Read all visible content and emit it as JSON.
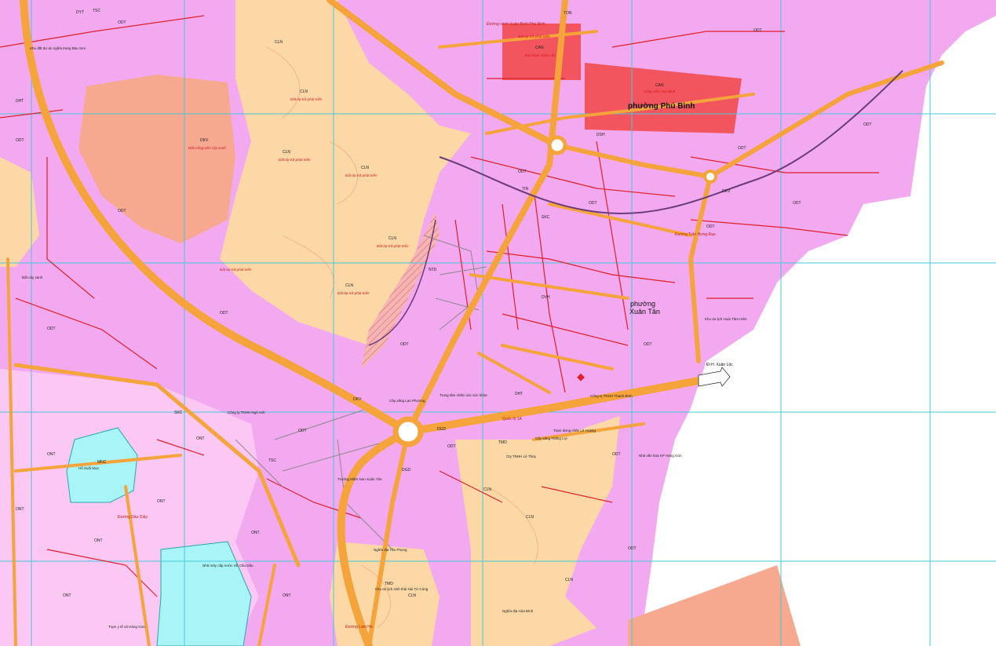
{
  "map": {
    "wards": [
      {
        "id": "phu-binh",
        "name": "phường Phú Bình"
      },
      {
        "id": "xuan-tan-1",
        "name": "phường"
      },
      {
        "id": "xuan-tan-2",
        "name": "Xuân Tân"
      }
    ],
    "directions": [
      {
        "id": "xuan-loc",
        "label": "Đi H. Xuân Lộc"
      }
    ],
    "roads": [
      {
        "id": "ql1a",
        "label": "Quốc lộ 1A"
      },
      {
        "id": "dau-giay",
        "label": "Đường Dầu Giây"
      },
      {
        "id": "dt-763",
        "label": "Đường Trần Hưng Đạo"
      },
      {
        "id": "xb",
        "label": "Đường vành Xuân Bình-Phú Bình"
      },
      {
        "id": "lang-ha",
        "label": "Đường Lâm Hà"
      }
    ],
    "land_codes": [
      {
        "id": "c1",
        "text": "CLN"
      },
      {
        "id": "c2",
        "text": "CLN"
      },
      {
        "id": "c3",
        "text": "CLN"
      },
      {
        "id": "c4",
        "text": "CLN"
      },
      {
        "id": "c5",
        "text": "CLN"
      },
      {
        "id": "c6",
        "text": "CLN"
      },
      {
        "id": "c7",
        "text": "CLN"
      },
      {
        "id": "c8",
        "text": "CLN"
      },
      {
        "id": "c9",
        "text": "CLN"
      },
      {
        "id": "c10",
        "text": "CLN"
      },
      {
        "id": "o1",
        "text": "ODT"
      },
      {
        "id": "o2",
        "text": "ODT"
      },
      {
        "id": "o3",
        "text": "ODT"
      },
      {
        "id": "o4",
        "text": "ODT"
      },
      {
        "id": "o5",
        "text": "ODT"
      },
      {
        "id": "o6",
        "text": "ODT"
      },
      {
        "id": "o7",
        "text": "ODT"
      },
      {
        "id": "o8",
        "text": "ODT"
      },
      {
        "id": "o9",
        "text": "ODT"
      },
      {
        "id": "o10",
        "text": "ODT"
      },
      {
        "id": "o11",
        "text": "ODT"
      },
      {
        "id": "o12",
        "text": "ODT"
      },
      {
        "id": "o13",
        "text": "ODT"
      },
      {
        "id": "o14",
        "text": "ODT"
      },
      {
        "id": "o15",
        "text": "ODT"
      },
      {
        "id": "o16",
        "text": "ODT"
      },
      {
        "id": "o17",
        "text": "ODT"
      },
      {
        "id": "o18",
        "text": "ODT"
      },
      {
        "id": "n1",
        "text": "ONT"
      },
      {
        "id": "n2",
        "text": "ONT"
      },
      {
        "id": "n3",
        "text": "ONT"
      },
      {
        "id": "n4",
        "text": "ONT"
      },
      {
        "id": "n5",
        "text": "ONT"
      },
      {
        "id": "n6",
        "text": "ONT"
      },
      {
        "id": "n7",
        "text": "ONT"
      },
      {
        "id": "n8",
        "text": "ONT"
      },
      {
        "id": "can1",
        "text": "CAN"
      },
      {
        "id": "can2",
        "text": "CAN"
      },
      {
        "id": "dkv1",
        "text": "DKV"
      },
      {
        "id": "dkv2",
        "text": "DKV"
      },
      {
        "id": "dkv3",
        "text": "DKV"
      },
      {
        "id": "skc1",
        "text": "SKC"
      },
      {
        "id": "skc2",
        "text": "SKC"
      },
      {
        "id": "tmd1",
        "text": "TMD"
      },
      {
        "id": "tmd2",
        "text": "TMD"
      },
      {
        "id": "mnc1",
        "text": "MNC"
      },
      {
        "id": "dht1",
        "text": "DHT"
      },
      {
        "id": "dht2",
        "text": "DHT"
      },
      {
        "id": "tsc1",
        "text": "TSC"
      },
      {
        "id": "tsc2",
        "text": "TSC"
      },
      {
        "id": "dgd1",
        "text": "DGD"
      },
      {
        "id": "dgd2",
        "text": "DGD"
      },
      {
        "id": "ntd1",
        "text": "NTD"
      },
      {
        "id": "dsh1",
        "text": "DSH"
      },
      {
        "id": "dvh1",
        "text": "DVH"
      },
      {
        "id": "tin1",
        "text": "TIN"
      },
      {
        "id": "dyt1",
        "text": "DYT"
      },
      {
        "id": "ton1",
        "text": "TON"
      }
    ],
    "annotations": [
      {
        "id": "a1",
        "text": "Đất dự trữ phát triển"
      },
      {
        "id": "a2",
        "text": "Đất dự trữ phát triển"
      },
      {
        "id": "a3",
        "text": "Đất dự trữ phát triển"
      },
      {
        "id": "a4",
        "text": "Đất dự trữ phát triển"
      },
      {
        "id": "a5",
        "text": "Đất dự trữ phát triển"
      },
      {
        "id": "a6",
        "text": "Đất dự trữ phát triển"
      },
      {
        "id": "a7",
        "text": "Đất dự trữ phát triển"
      },
      {
        "id": "a8",
        "text": "Đất Công viên cây xanh"
      },
      {
        "id": "a9",
        "text": "Công viên Hòa Bình"
      },
      {
        "id": "a10",
        "text": "Trại Giam Xuân Lộc"
      },
      {
        "id": "a11",
        "text": "Hồ Suối Mực"
      },
      {
        "id": "a12",
        "text": "Nhà máy cấp nước Hồ Cầu Dầu"
      },
      {
        "id": "a13",
        "text": "Khu du lịch sinh thái Núi Tứ Cúng"
      },
      {
        "id": "a14",
        "text": "Công ty TNHH Thanh Bình"
      },
      {
        "id": "a15",
        "text": "Cây xăng Lan Phương"
      },
      {
        "id": "a16",
        "text": "Trung tâm chăm sóc sức khỏe"
      },
      {
        "id": "a17",
        "text": "Trường Mầm Non Xuân Tân"
      },
      {
        "id": "a18",
        "text": "Nghĩa địa Tân Phong"
      },
      {
        "id": "a19",
        "text": "Nghĩa địa Hòa Bình"
      },
      {
        "id": "a20",
        "text": "Trạm dừng chân Lê Hoàng"
      },
      {
        "id": "a21",
        "text": "Cty TNHH Lê Thủy"
      },
      {
        "id": "a22",
        "text": "Cây xăng Thắng Lợi"
      },
      {
        "id": "a23",
        "text": "Công ty TNHH Ngô Anh"
      },
      {
        "id": "a24",
        "text": "Khu du lịch Hoài Tâm Hiên"
      },
      {
        "id": "a25",
        "text": "Nhà văn hóa KP Hàng Gòn"
      },
      {
        "id": "a26",
        "text": "Trạm y tế xã Hàng Gòn"
      },
      {
        "id": "a27",
        "text": "Đất cây xanh"
      },
      {
        "id": "a28",
        "text": "Khu đất dự án nghĩa trang Bàu Sen"
      }
    ],
    "colors": {
      "residential": "#f2a9f0",
      "rural_residential": "#fbc8f3",
      "perennial_crop": "#fbd8a6",
      "park": "#f6a98f",
      "security": "#f2555d",
      "water": "#a9f4f6",
      "road": "#f5a43c",
      "lot_line": "#e0202a",
      "grid": "#46c8d8",
      "outside": "#ffffff"
    }
  }
}
